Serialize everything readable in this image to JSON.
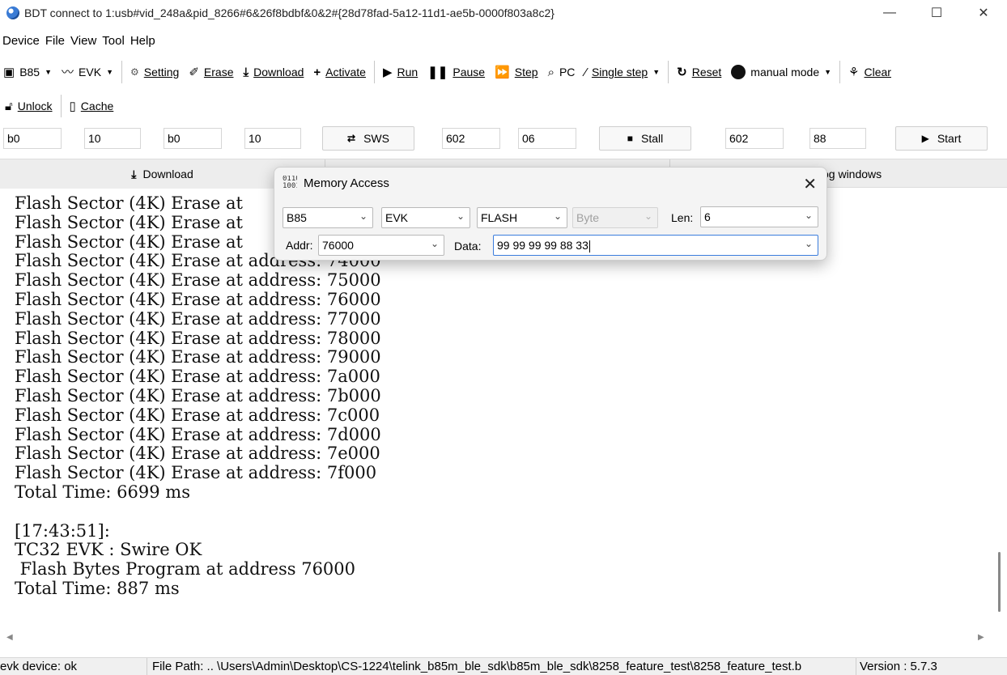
{
  "window": {
    "title": "BDT connect to 1:usb#vid_248a&pid_8266#6&26f8bdbf&0&2#{28d78fad-5a12-11d1-ae5b-0000f803a8c2}",
    "minimize": "—",
    "maximize": "☐",
    "close": "✕"
  },
  "menu": [
    "Device",
    "File",
    "View",
    "Tool",
    "Help"
  ],
  "toolbar": {
    "chip": "B85",
    "board": "EVK",
    "setting": "Setting",
    "erase": "Erase",
    "download": "Download",
    "activate": "Activate",
    "run": "Run",
    "pause": "Pause",
    "step": "Step",
    "pc": "PC",
    "single_step": "Single step",
    "reset": "Reset",
    "mode": "manual mode",
    "clear": "Clear"
  },
  "toolbar2": {
    "unlock": "Unlock",
    "cache": "Cache"
  },
  "registers": {
    "f1": "b0",
    "f2": "10",
    "f3": "b0",
    "f4": "10",
    "sws": "SWS",
    "f5": "602",
    "f6": "06",
    "stall": "Stall",
    "f7": "602",
    "f8": "88",
    "start": "Start"
  },
  "tabs": {
    "download": "Download",
    "middle": "",
    "log": "og windows"
  },
  "log": {
    "lines_top": [
      "Flash Sector (4K) Erase at",
      "Flash Sector (4K) Erase at",
      "Flash Sector (4K) Erase at",
      "Flash Sector (4K) Erase at address: 74000",
      "Flash Sector (4K) Erase at address: 75000",
      "Flash Sector (4K) Erase at address: 76000",
      "Flash Sector (4K) Erase at address: 77000",
      "Flash Sector (4K) Erase at address: 78000",
      "Flash Sector (4K) Erase at address: 79000",
      "Flash Sector (4K) Erase at address: 7a000",
      "Flash Sector (4K) Erase at address: 7b000",
      "Flash Sector (4K) Erase at address: 7c000",
      "Flash Sector (4K) Erase at address: 7d000",
      "Flash Sector (4K) Erase at address: 7e000",
      "Flash Sector (4K) Erase at address: 7f000",
      "Total Time: 6699 ms"
    ],
    "lines_bottom": [
      "[17:43:51]:",
      "TC32 EVK : Swire OK",
      " Flash Bytes Program at address 76000",
      "Total Time: 887 ms"
    ]
  },
  "statusbar": {
    "device": "evk device: ok",
    "path": "File Path:  ..  \\Users\\Admin\\Desktop\\CS-1224\\telink_b85m_ble_sdk\\b85m_ble_sdk\\8258_feature_test\\8258_feature_test.b",
    "version": "Version : 5.7.3"
  },
  "dialog": {
    "title": "Memory Access",
    "chip": "B85",
    "board": "EVK",
    "memory": "FLASH",
    "unit": "Byte",
    "len_label": "Len:",
    "len": "6",
    "addr_label": "Addr:",
    "addr": "76000",
    "data_label": "Data:",
    "data": "99 99 99 99 88 33"
  }
}
